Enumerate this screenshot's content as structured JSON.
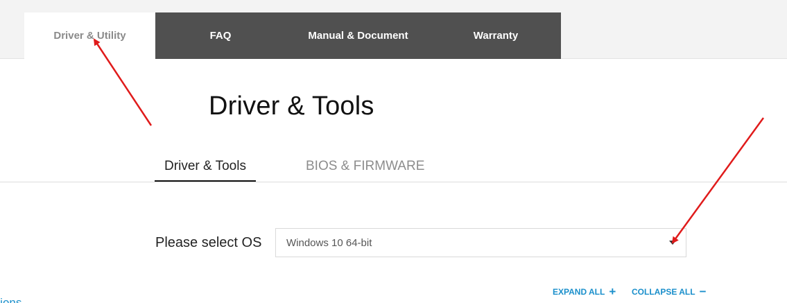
{
  "tabs": [
    {
      "label": "Driver & Utility",
      "active": true
    },
    {
      "label": "FAQ",
      "active": false
    },
    {
      "label": "Manual & Document",
      "active": false
    },
    {
      "label": "Warranty",
      "active": false
    }
  ],
  "page_title": "Driver & Tools",
  "subtabs": [
    {
      "label": "Driver & Tools",
      "active": true
    },
    {
      "label": "BIOS & FIRMWARE",
      "active": false
    }
  ],
  "os_select": {
    "label": "Please select OS",
    "value": "Windows 10 64-bit"
  },
  "controls": {
    "expand_all": "EXPAND ALL",
    "expand_icon": "+",
    "collapse_all": "COLLAPSE ALL",
    "collapse_icon": "−"
  },
  "cut_link": "ations",
  "colors": {
    "accent": "#1a8fcb",
    "tab_dark": "#505050",
    "annotation_arrow": "#e01b1b"
  }
}
